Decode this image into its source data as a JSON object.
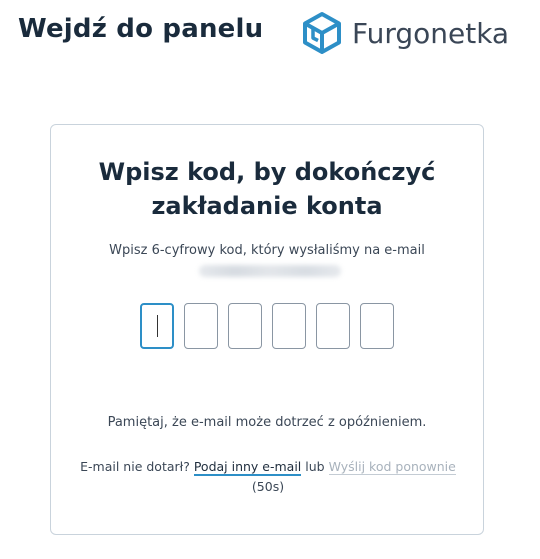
{
  "header": {
    "title": "Wejdź do panelu",
    "logo_text": "Furgonetka",
    "logo_icon": "furgonetka-box-logo-icon",
    "brand_color": "#2d8fc7"
  },
  "card": {
    "title_line1": "Wpisz kod, by dokończyć",
    "title_line2": "zakładanie konta",
    "instruction": "Wpisz 6-cyfrowy kod, który wysłaliśmy na e-mail",
    "code": {
      "length": 6,
      "digits": [
        "",
        "",
        "",
        "",
        "",
        ""
      ],
      "focused_index": 0
    },
    "note": "Pamiętaj, że e-mail może dotrzeć z opóźnieniem.",
    "resend": {
      "prefix": "E-mail nie dotarł?",
      "change_email_link": "Podaj inny e-mail",
      "or": "lub",
      "resend_link": "Wyślij kod ponownie",
      "countdown": "(50s)"
    }
  }
}
